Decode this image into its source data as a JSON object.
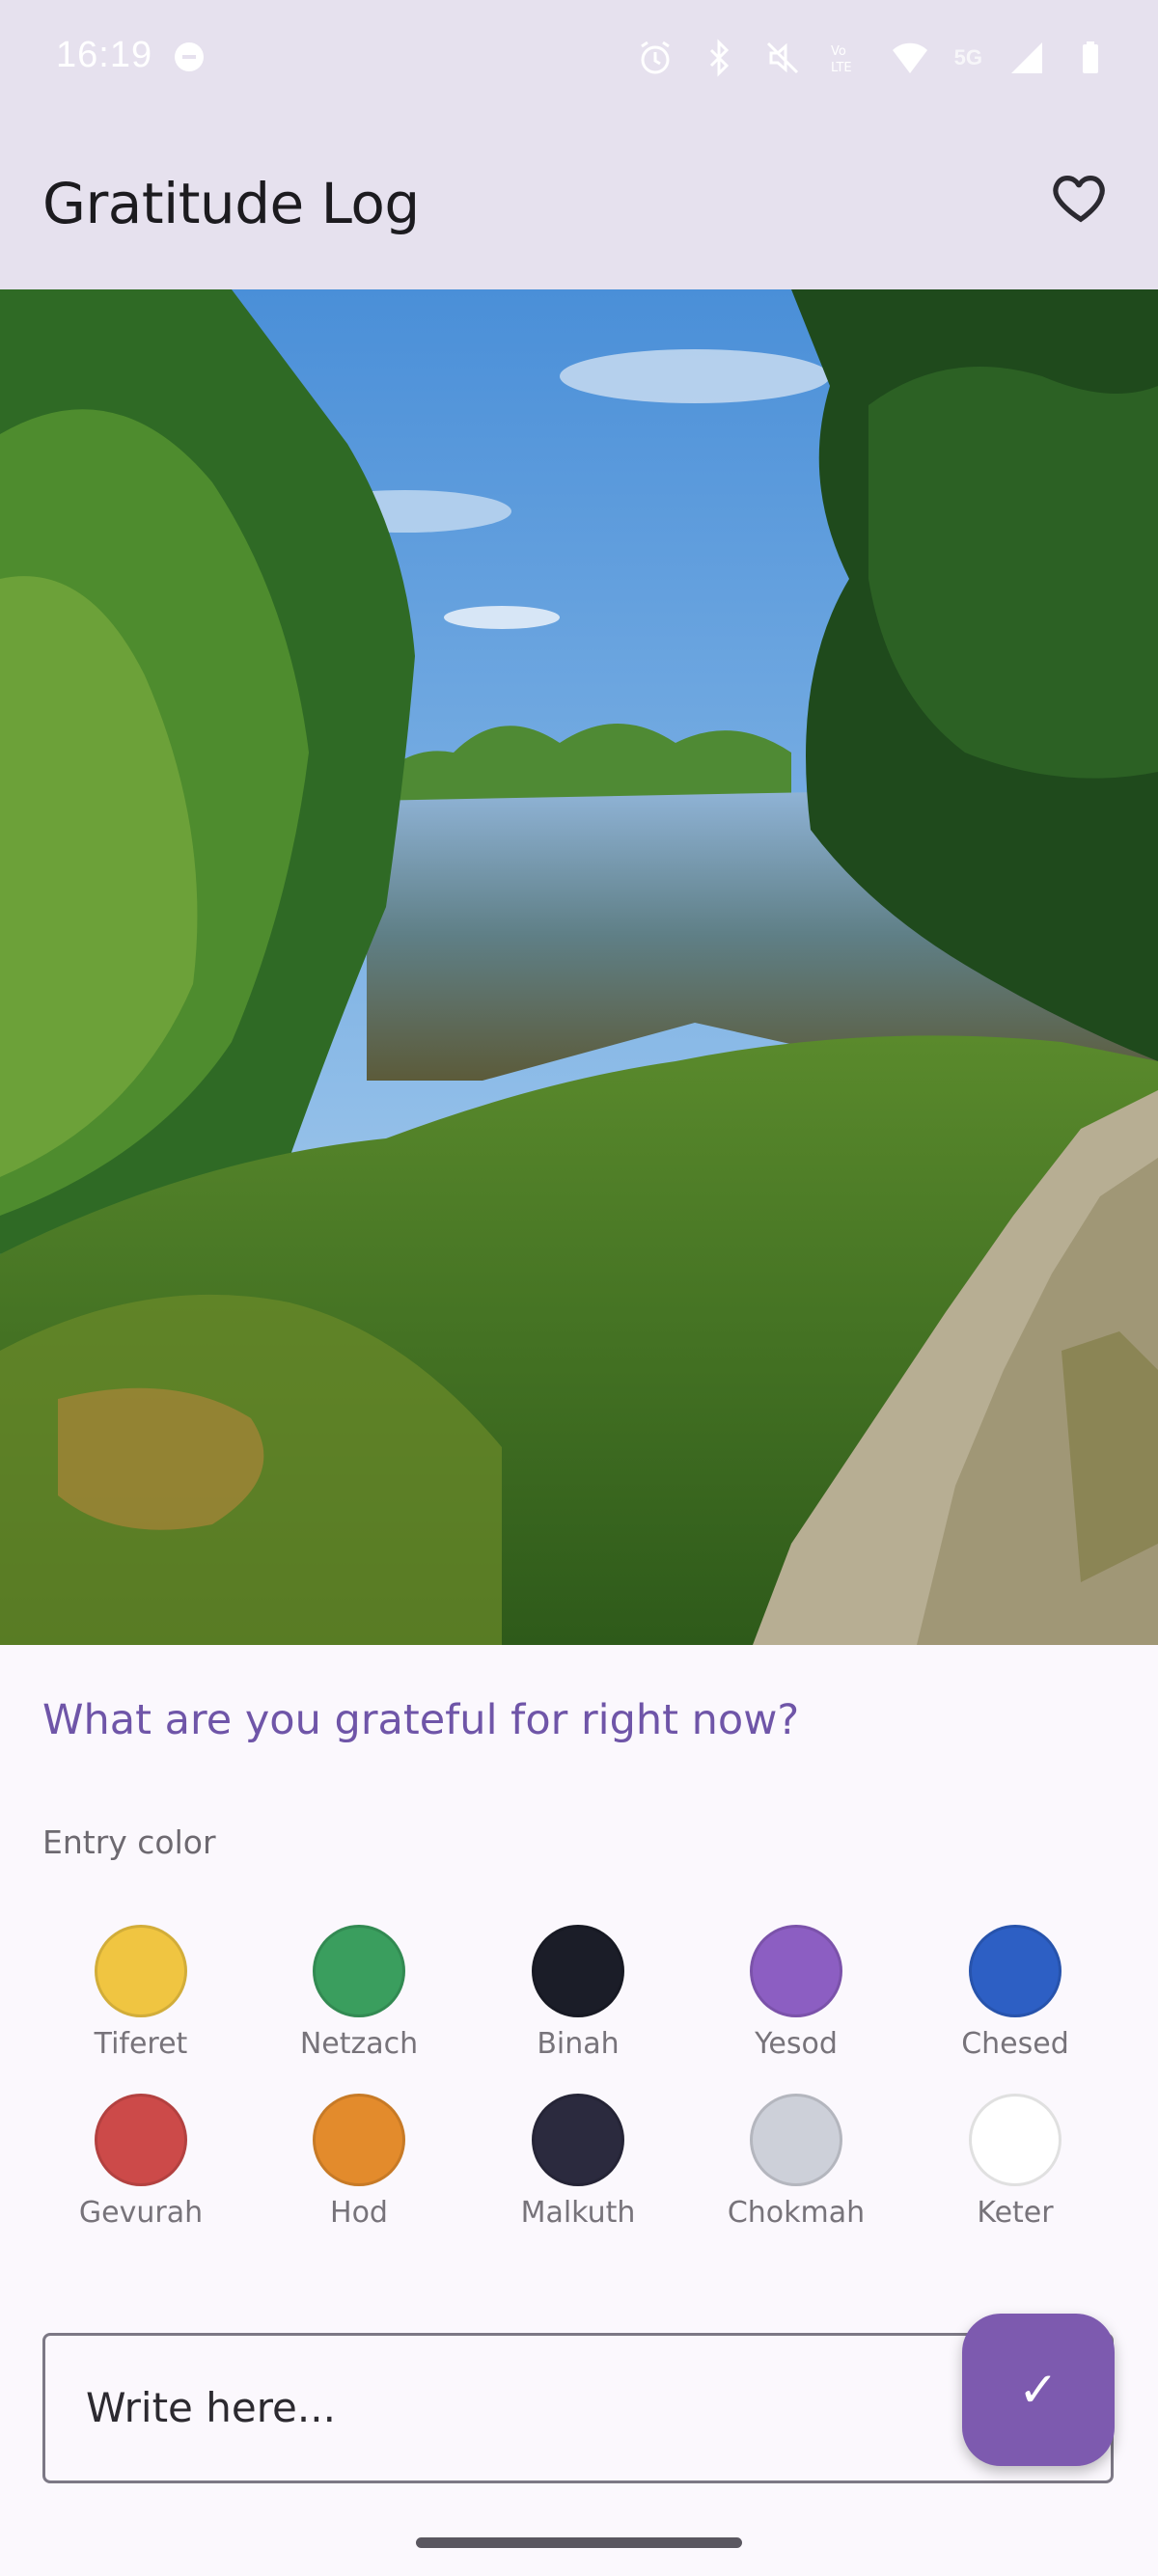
{
  "status_bar": {
    "time": "16:19",
    "network": "5G",
    "icons": [
      "do-not-disturb-icon",
      "alarm-icon",
      "bluetooth-icon",
      "mute-icon",
      "volte-icon",
      "wifi-icon",
      "signal-icon",
      "battery-icon"
    ]
  },
  "app_bar": {
    "title": "Gratitude Log",
    "favorite_icon": "heart-outline-icon"
  },
  "photo": {
    "subject": "pond-landscape-photo"
  },
  "content": {
    "prompt": "What are you grateful for right now?",
    "entry_color_label": "Entry color",
    "colors": [
      {
        "name": "Tiferet",
        "hex": "#f0c541"
      },
      {
        "name": "Netzach",
        "hex": "#3a9e5e"
      },
      {
        "name": "Binah",
        "hex": "#1b1d28"
      },
      {
        "name": "Yesod",
        "hex": "#8c5ec2"
      },
      {
        "name": "Chesed",
        "hex": "#2d5fc4"
      },
      {
        "name": "Gevurah",
        "hex": "#cc4a49"
      },
      {
        "name": "Hod",
        "hex": "#e38b2c"
      },
      {
        "name": "Malkuth",
        "hex": "#2b2a3e"
      },
      {
        "name": "Chokmah",
        "hex": "#cdd0d9"
      },
      {
        "name": "Keter",
        "hex": "#ffffff"
      }
    ],
    "input_placeholder": "Write here...",
    "submit_glyph": "✓"
  },
  "theme": {
    "accent": "#7d5aaf",
    "app_bar_bg": "#e6e1ee"
  }
}
